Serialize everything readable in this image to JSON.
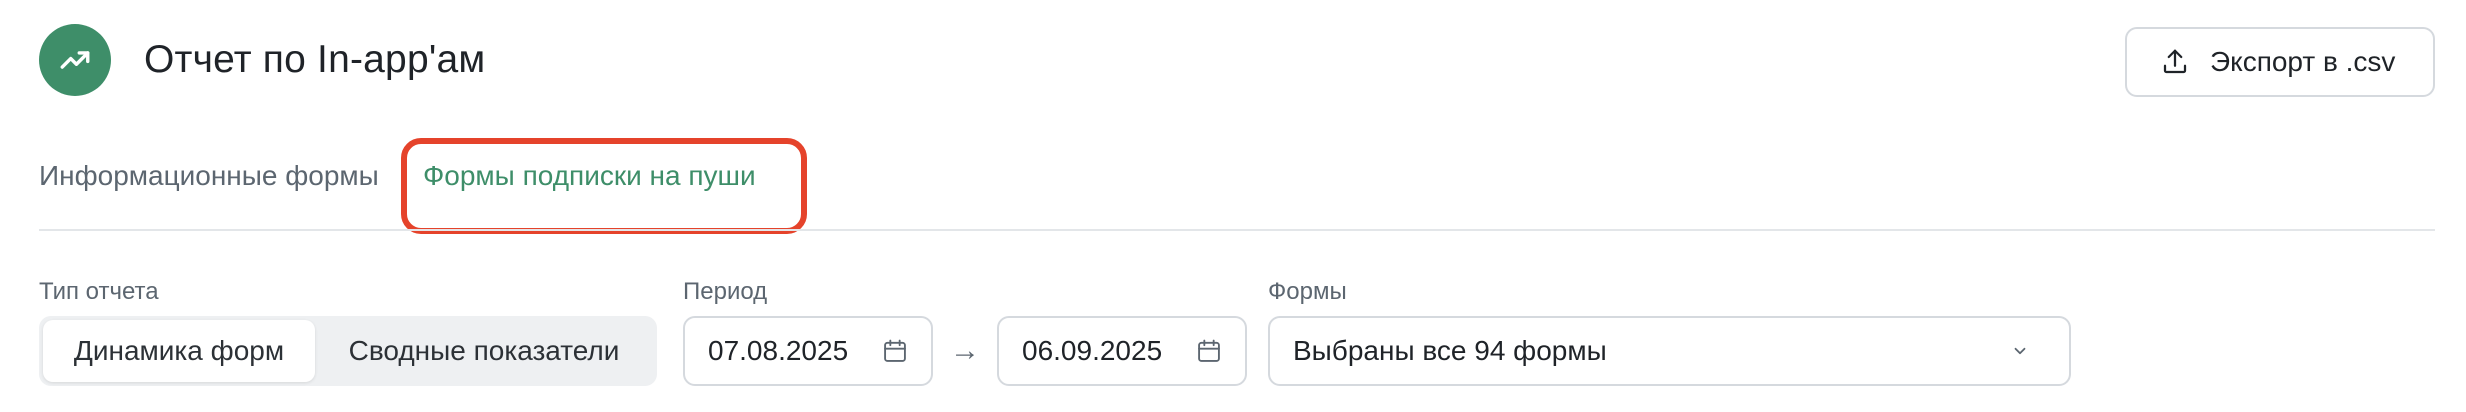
{
  "header": {
    "logo_icon": "trending-up-icon",
    "title": "Отчет по In-app'ам",
    "export_label": "Экспорт в .csv",
    "export_icon": "upload-icon",
    "accent_color": "#3e8e69"
  },
  "tabs": [
    {
      "label": "Информационные формы",
      "active": false
    },
    {
      "label": "Формы подписки на пуши",
      "active": true
    }
  ],
  "highlight_color": "#e5432b",
  "filters": {
    "report_type": {
      "label": "Тип отчета",
      "options": [
        "Динамика форм",
        "Сводные показатели"
      ],
      "selected": "Динамика форм"
    },
    "period": {
      "label": "Период",
      "from": "07.08.2025",
      "to": "06.09.2025",
      "separator": "→",
      "icon": "calendar-icon"
    },
    "forms": {
      "label": "Формы",
      "value": "Выбраны все 94 формы",
      "icon": "chevron-down-icon"
    }
  }
}
